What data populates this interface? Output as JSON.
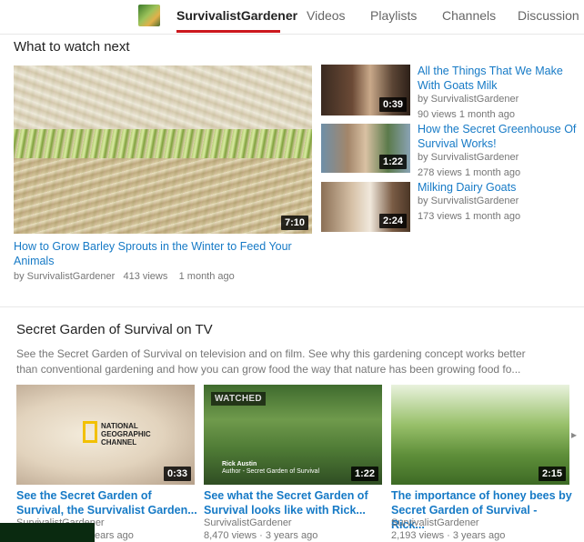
{
  "nav": {
    "channel": "SurvivalistGardener",
    "tabs": [
      "Videos",
      "Playlists",
      "Channels",
      "Discussion"
    ]
  },
  "section1": {
    "title": "What to watch next",
    "featured": {
      "title": "How to Grow Barley Sprouts in the Winter to Feed Your Animals",
      "channel": "by SurvivalistGardener",
      "views": "413 views",
      "age": "1 month ago",
      "duration": "7:10"
    },
    "side": [
      {
        "title": "All the Things That We Make With Goats Milk",
        "channel": "by SurvivalistGardener",
        "meta": "90 views   1 month ago",
        "duration": "0:39"
      },
      {
        "title": "How the Secret Greenhouse Of Survival Works!",
        "channel": "by SurvivalistGardener",
        "meta": "278 views   1 month ago",
        "duration": "1:22"
      },
      {
        "title": "Milking Dairy Goats",
        "channel": "by SurvivalistGardener",
        "meta": "173 views   1 month ago",
        "duration": "2:24"
      }
    ]
  },
  "section2": {
    "title": "Secret Garden of Survival on TV",
    "description": "See the Secret Garden of Survival on television and on film. See why this gardening concept works better than conventional gardening and how you can grow food the way that nature has been growing food fo...",
    "videos": [
      {
        "title": "See the Secret Garden of Survival, the Survivalist Garden...",
        "channel": "SurvivalistGardener",
        "meta": "ears ago",
        "duration": "0:33",
        "overlay": "NATIONAL GEOGRAPHIC CHANNEL"
      },
      {
        "title": "See what the Secret Garden of Survival looks like with Rick...",
        "channel": "SurvivalistGardener",
        "meta": "8,470 views · 3 years ago",
        "duration": "1:22",
        "badge": "WATCHED",
        "overlay_name": "Rick Austin",
        "overlay_role": "Author - Secret Garden of Survival"
      },
      {
        "title": "The importance of honey bees by Secret Garden of Survival - Rick...",
        "channel": "SurvivalistGardener",
        "meta": "2,193 views · 3 years ago",
        "duration": "2:15"
      }
    ]
  },
  "icons": {
    "next": "chevron-right-icon",
    "avatar": "channel-avatar"
  },
  "colors": {
    "link": "#167ac6",
    "accent": "#cc181e",
    "meta": "#767676"
  }
}
